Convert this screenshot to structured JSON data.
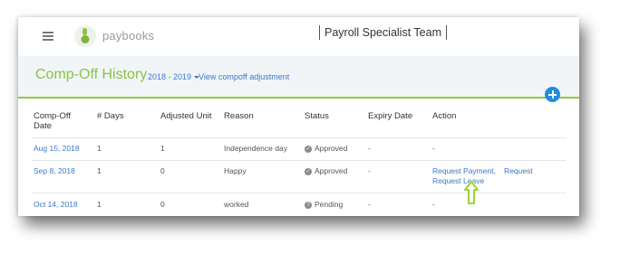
{
  "header": {
    "brand": "paybooks",
    "team": "Payroll Specialist Team"
  },
  "subheader": {
    "title": "Comp-Off History",
    "year": "2018 - 2019",
    "view_link": "View compoff adjustment"
  },
  "table": {
    "columns": [
      "Comp-Off Date",
      "# Days",
      "Adjusted Unit",
      "Reason",
      "Status",
      "Expiry Date",
      "Action"
    ],
    "rows": [
      {
        "date": "Aug 15, 2018",
        "days": "1",
        "adjusted": "1",
        "reason": "Independence day",
        "status": "Approved",
        "expiry": "-",
        "action": "-"
      },
      {
        "date": "Sep 8, 2018",
        "days": "1",
        "adjusted": "0",
        "reason": "Happy",
        "status": "Approved",
        "expiry": "-",
        "action_link1": "Request Payment,",
        "action_link2": "Request Leave"
      },
      {
        "date": "Oct 14, 2018",
        "days": "1",
        "adjusted": "0",
        "reason": "worked",
        "status": "Pending",
        "expiry": "-",
        "action": "-"
      }
    ]
  },
  "colors": {
    "accent_green": "#8bc34a",
    "link_blue": "#3c78c8",
    "add_button": "#1f8de0",
    "arrow_green": "#9ad43a"
  },
  "icons": {
    "menu": "hamburger-icon",
    "logo": "paybooks-logo-icon",
    "approved": "check-circle-icon",
    "pending": "question-circle-icon",
    "add": "plus-circle-icon",
    "annotation": "up-arrow-icon"
  }
}
